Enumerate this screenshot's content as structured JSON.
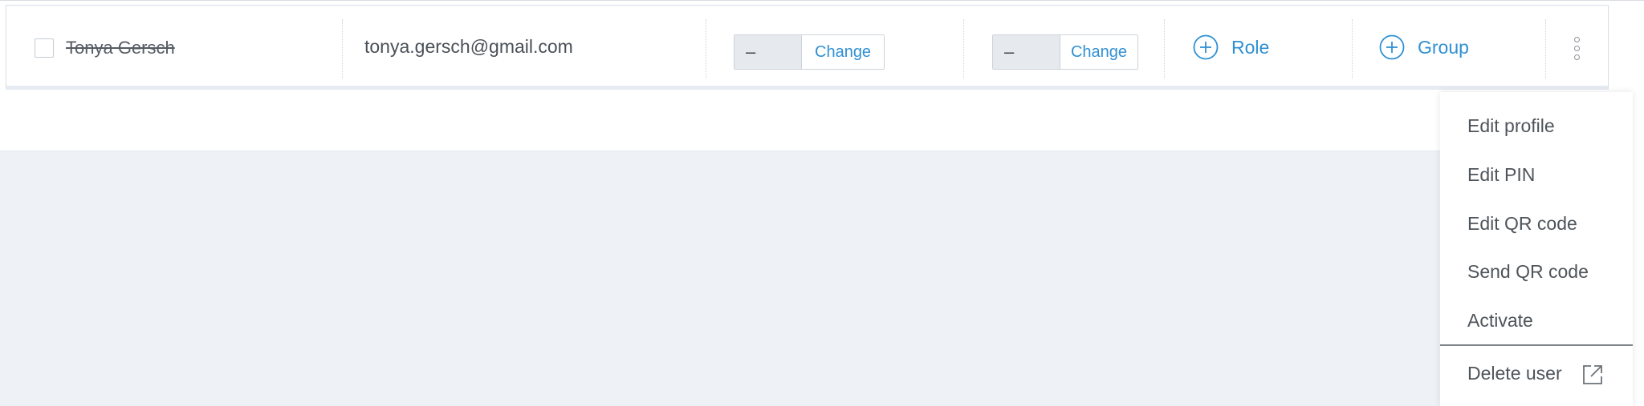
{
  "user_row": {
    "name": "Tonya Gersch",
    "email": "tonya.gersch@gmail.com",
    "field_a": {
      "value": "–",
      "button_label": "Change"
    },
    "field_b": {
      "value": "–",
      "button_label": "Change"
    },
    "add_role_label": "Role",
    "add_group_label": "Group"
  },
  "context_menu": {
    "items": [
      "Edit profile",
      "Edit PIN",
      "Edit QR code",
      "Send QR code",
      "Activate"
    ],
    "delete_label": "Delete user"
  },
  "icons": {
    "add_role": "plus-circle-icon",
    "add_group": "plus-circle-icon",
    "more": "kebab-menu-icon",
    "delete": "external-link-icon"
  },
  "colors": {
    "accent": "#2f90d3",
    "background": "#eef1f5",
    "text": "#4a5057"
  }
}
